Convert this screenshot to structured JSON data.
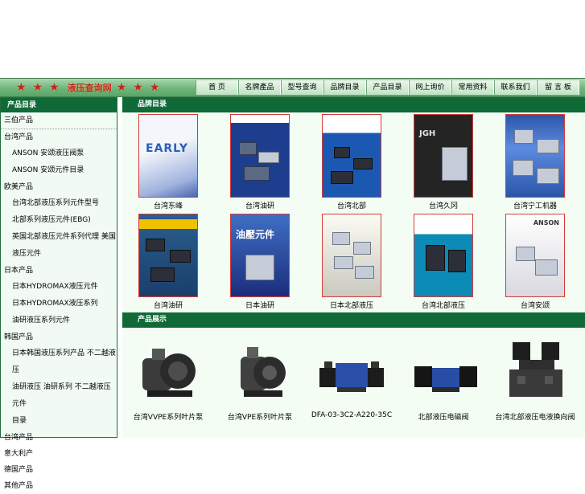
{
  "nav": {
    "brand": "液压查询网",
    "items": [
      "首 页",
      "名牌產品",
      "型号查询",
      "品牌目录",
      "产品目录",
      "网上询价",
      "常用资料",
      "联系我们",
      "留 言 板"
    ]
  },
  "sidebar": {
    "heading": "产品目录",
    "groups": [
      {
        "title": "三伯产品",
        "items": []
      },
      {
        "title": "台湾产品",
        "items": [
          "ANSON 安颂液压阀泵",
          "ANSON 安颂元件目录"
        ]
      },
      {
        "title": "欧美产品",
        "items": [
          "台湾北部液压系列元件型号",
          "北部系列液压元件(EBG)",
          "英国北部液压元件系列代理   美国液压元件"
        ]
      },
      {
        "title": "日本产品",
        "items": [
          "日本HYDROMAX液压元件",
          "日本HYDROMAX液压系列",
          "油研液压系列元件"
        ]
      },
      {
        "title": "韩国产品",
        "items": [
          "日本韩国液压系列产品   不二越液压",
          "油研液压   油研系列   不二越液压元件",
          "目录"
        ]
      },
      {
        "title": "台湾产品",
        "items": []
      },
      {
        "title": "意大利产",
        "items": []
      },
      {
        "title": "德国产品",
        "items": []
      },
      {
        "title": "其他产品",
        "items": []
      }
    ]
  },
  "catalog": {
    "heading": "品牌目录",
    "items": [
      "台湾东峰",
      "台湾油研",
      "台湾北部",
      "台湾久冈",
      "台湾宁工机器",
      "台湾油研",
      "日本油研",
      "日本北部液压",
      "台湾北部液压",
      "台湾安颂"
    ],
    "cover_texts": {
      "early": "EARLY",
      "dark": "JGH",
      "yuken": "油壓元件",
      "anson": "ANSON"
    }
  },
  "products": {
    "heading": "产品展示",
    "items": [
      "台湾VVPE系列叶片泵",
      "台湾VPE系列叶片泵",
      "DFA-03-3C2-A220-35C",
      "北部液压电磁阀",
      "台湾北部液压电液换向阀"
    ]
  },
  "colors": {
    "green_dark": "#0f6a37",
    "nav_red": "#c0261e",
    "cover_border": "#d33b3b"
  }
}
